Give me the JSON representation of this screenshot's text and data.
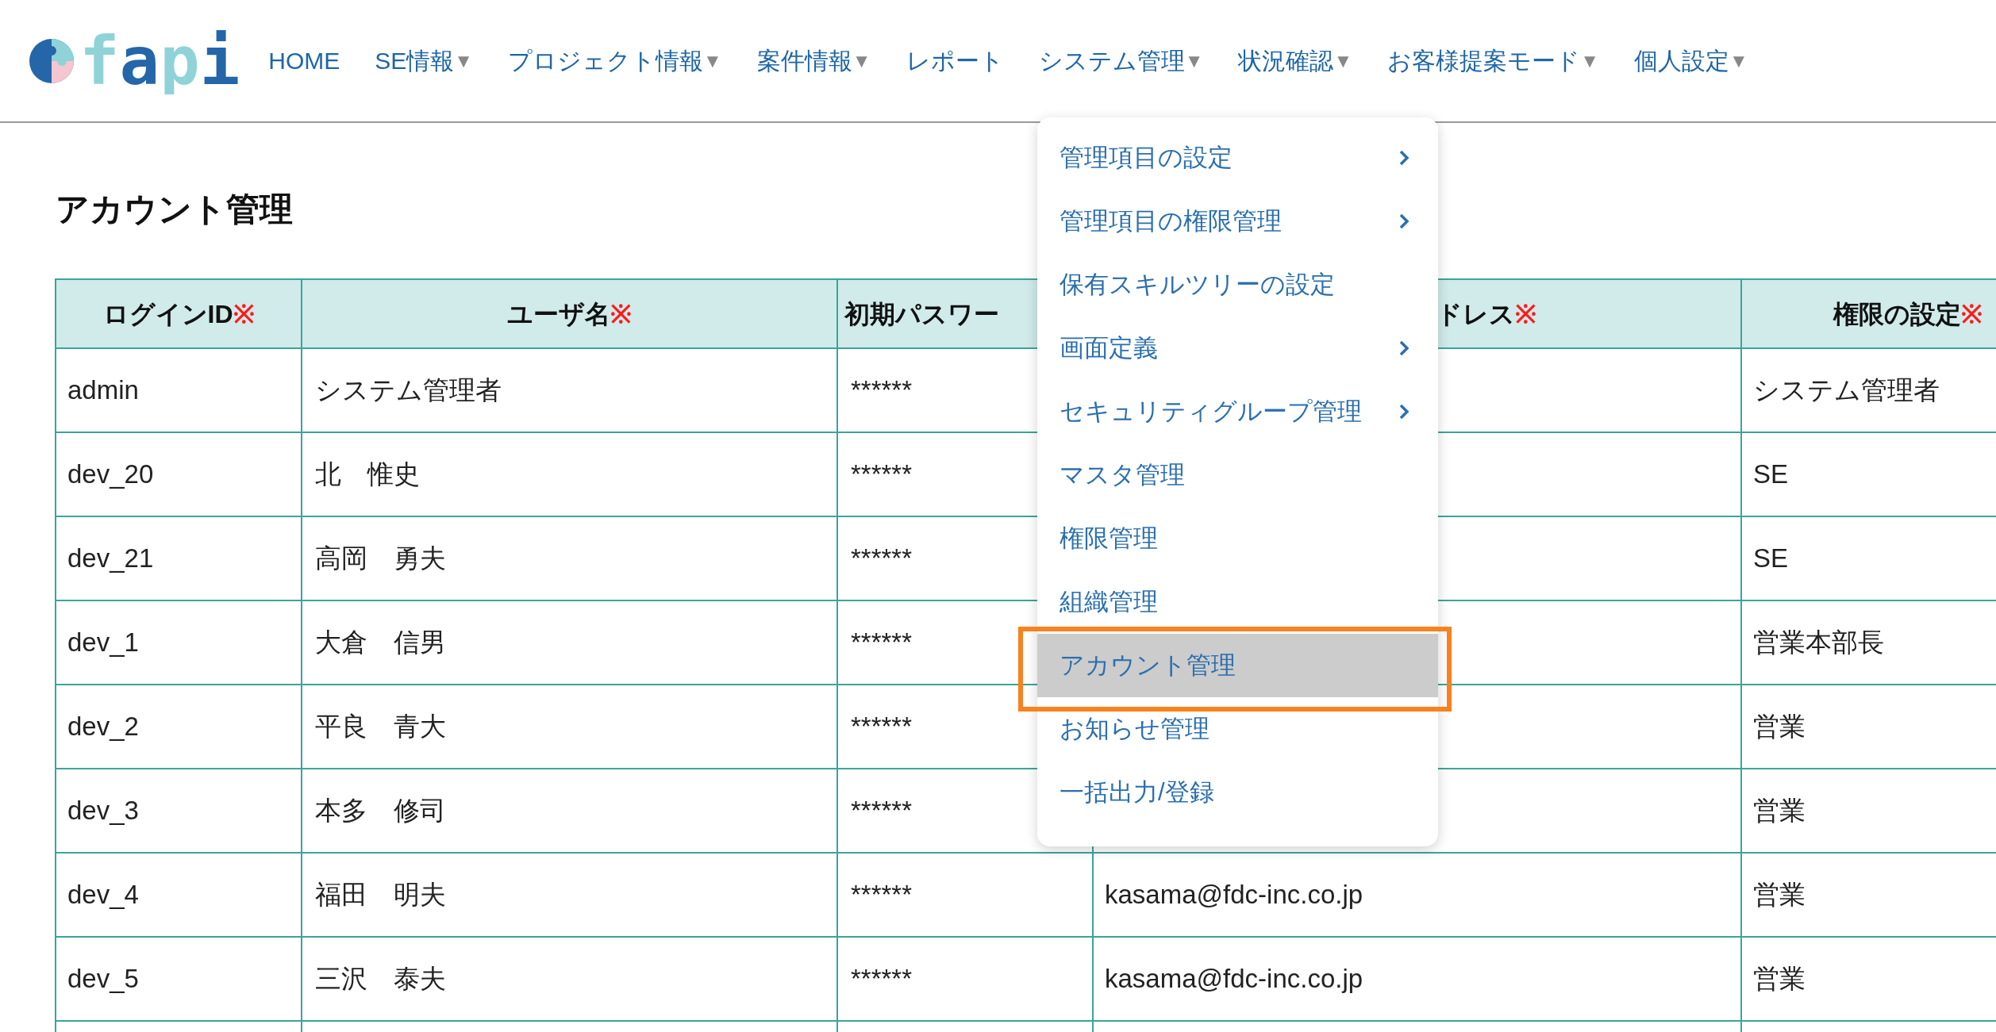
{
  "logo": {
    "text": "fapi"
  },
  "nav": [
    {
      "label": "HOME"
    },
    {
      "label": "SE情報",
      "caret": "▼"
    },
    {
      "label": "プロジェクト情報",
      "caret": "▼"
    },
    {
      "label": "案件情報",
      "caret": "▼"
    },
    {
      "label": "レポート"
    },
    {
      "label": "システム管理",
      "caret": "▼"
    },
    {
      "label": "状況確認",
      "caret": "▼"
    },
    {
      "label": "お客様提案モード",
      "caret": "▼"
    },
    {
      "label": "個人設定",
      "caret": "▼"
    }
  ],
  "page_title": "アカウント管理",
  "table": {
    "columns": [
      {
        "label": "ログインID",
        "required": "※"
      },
      {
        "label": "ユーザ名",
        "required": "※"
      },
      {
        "label": "初期パスワー"
      },
      {
        "label": "ドレス",
        "required": "※"
      },
      {
        "label": "権限の設定",
        "required": "※"
      }
    ],
    "rows": [
      {
        "login_id": "admin",
        "user_name": "システム管理者",
        "password": "******",
        "role": "システム管理者"
      },
      {
        "login_id": "dev_20",
        "user_name": "北　惟史",
        "password": "******",
        "role": "SE"
      },
      {
        "login_id": "dev_21",
        "user_name": "高岡　勇夫",
        "password": "******",
        "role": "SE"
      },
      {
        "login_id": "dev_1",
        "user_name": "大倉　信男",
        "password": "******",
        "role": "営業本部長"
      },
      {
        "login_id": "dev_2",
        "user_name": "平良　青大",
        "password": "******",
        "role": "営業"
      },
      {
        "login_id": "dev_3",
        "user_name": "本多　修司",
        "password": "******",
        "role": "営業"
      },
      {
        "login_id": "dev_4",
        "user_name": "福田　明夫",
        "password": "******",
        "email": "kasama@fdc-inc.co.jp",
        "role": "営業"
      },
      {
        "login_id": "dev_5",
        "user_name": "三沢　泰夫",
        "password": "******",
        "email": "kasama@fdc-inc.co.jp",
        "role": "営業"
      }
    ]
  },
  "dropdown": {
    "items": [
      {
        "label": "管理項目の設定",
        "submenu": true,
        "selected": false,
        "annotated": false
      },
      {
        "label": "管理項目の権限管理",
        "submenu": true,
        "selected": false,
        "annotated": false
      },
      {
        "label": "保有スキルツリーの設定",
        "submenu": false,
        "selected": false,
        "annotated": false
      },
      {
        "label": "画面定義",
        "submenu": true,
        "selected": false,
        "annotated": false
      },
      {
        "label": "セキュリティグループ管理",
        "submenu": true,
        "selected": false,
        "annotated": false
      },
      {
        "label": "マスタ管理",
        "submenu": false,
        "selected": false,
        "annotated": false
      },
      {
        "label": "権限管理",
        "submenu": false,
        "selected": false,
        "annotated": false
      },
      {
        "label": "組織管理",
        "submenu": false,
        "selected": false,
        "annotated": false
      },
      {
        "label": "アカウント管理",
        "submenu": false,
        "selected": true,
        "annotated": true
      },
      {
        "label": "お知らせ管理",
        "submenu": false,
        "selected": false,
        "annotated": false
      },
      {
        "label": "一括出力/登録",
        "submenu": false,
        "selected": false,
        "annotated": false
      }
    ]
  }
}
